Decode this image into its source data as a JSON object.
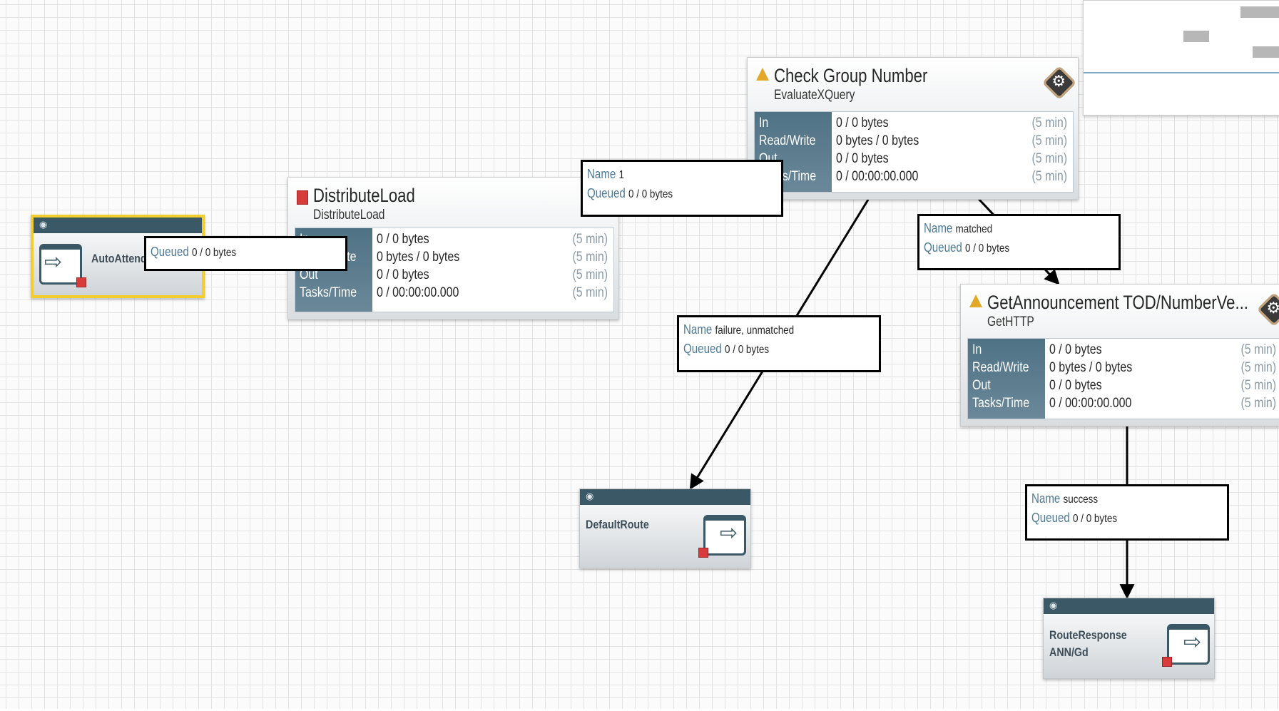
{
  "processors": {
    "distribute": {
      "title": "DistributeLoad",
      "type": "DistributeLoad",
      "state": "stopped"
    },
    "check": {
      "title": "Check Group Number",
      "type": "EvaluateXQuery",
      "state": "invalid"
    },
    "getann": {
      "title": "GetAnnouncement TOD/NumberVe...",
      "type": "GetHTTP",
      "state": "invalid"
    }
  },
  "stat_labels": {
    "in": "In",
    "readwrite": "Read/Write",
    "out": "Out",
    "tasks": "Tasks/Time"
  },
  "stat_values": {
    "in": "0 / 0 bytes",
    "readwrite": "0 bytes / 0 bytes",
    "out": "0 / 0 bytes",
    "tasks": "0 / 00:00:00.000",
    "window": "(5 min)"
  },
  "ports": {
    "auto": {
      "name": "AutoAttend",
      "kind": "input"
    },
    "default": {
      "name": "DefaultRoute",
      "kind": "output"
    },
    "route": {
      "name": "RouteResponse",
      "name2": "ANN/Gd",
      "kind": "output"
    }
  },
  "connections": {
    "auto_to_distribute": {
      "queued_key": "Queued",
      "queued": "0 / 0 bytes"
    },
    "distribute_to_check": {
      "name_key": "Name",
      "name": "1",
      "queued_key": "Queued",
      "queued": "0 / 0 bytes"
    },
    "check_to_default": {
      "name_key": "Name",
      "name": "failure, unmatched",
      "queued_key": "Queued",
      "queued": "0 / 0 bytes"
    },
    "check_to_getann": {
      "name_key": "Name",
      "name": "matched",
      "queued_key": "Queued",
      "queued": "0 / 0 bytes"
    },
    "getann_to_route": {
      "name_key": "Name",
      "name": "success",
      "queued_key": "Queued",
      "queued": "0 / 0 bytes"
    }
  },
  "colors": {
    "selected_border": "#f2cd2c",
    "stat_header": "#4f7285",
    "label_key": "#4f7a96",
    "stopped": "#d83b3b",
    "warning": "#e1a82a"
  }
}
